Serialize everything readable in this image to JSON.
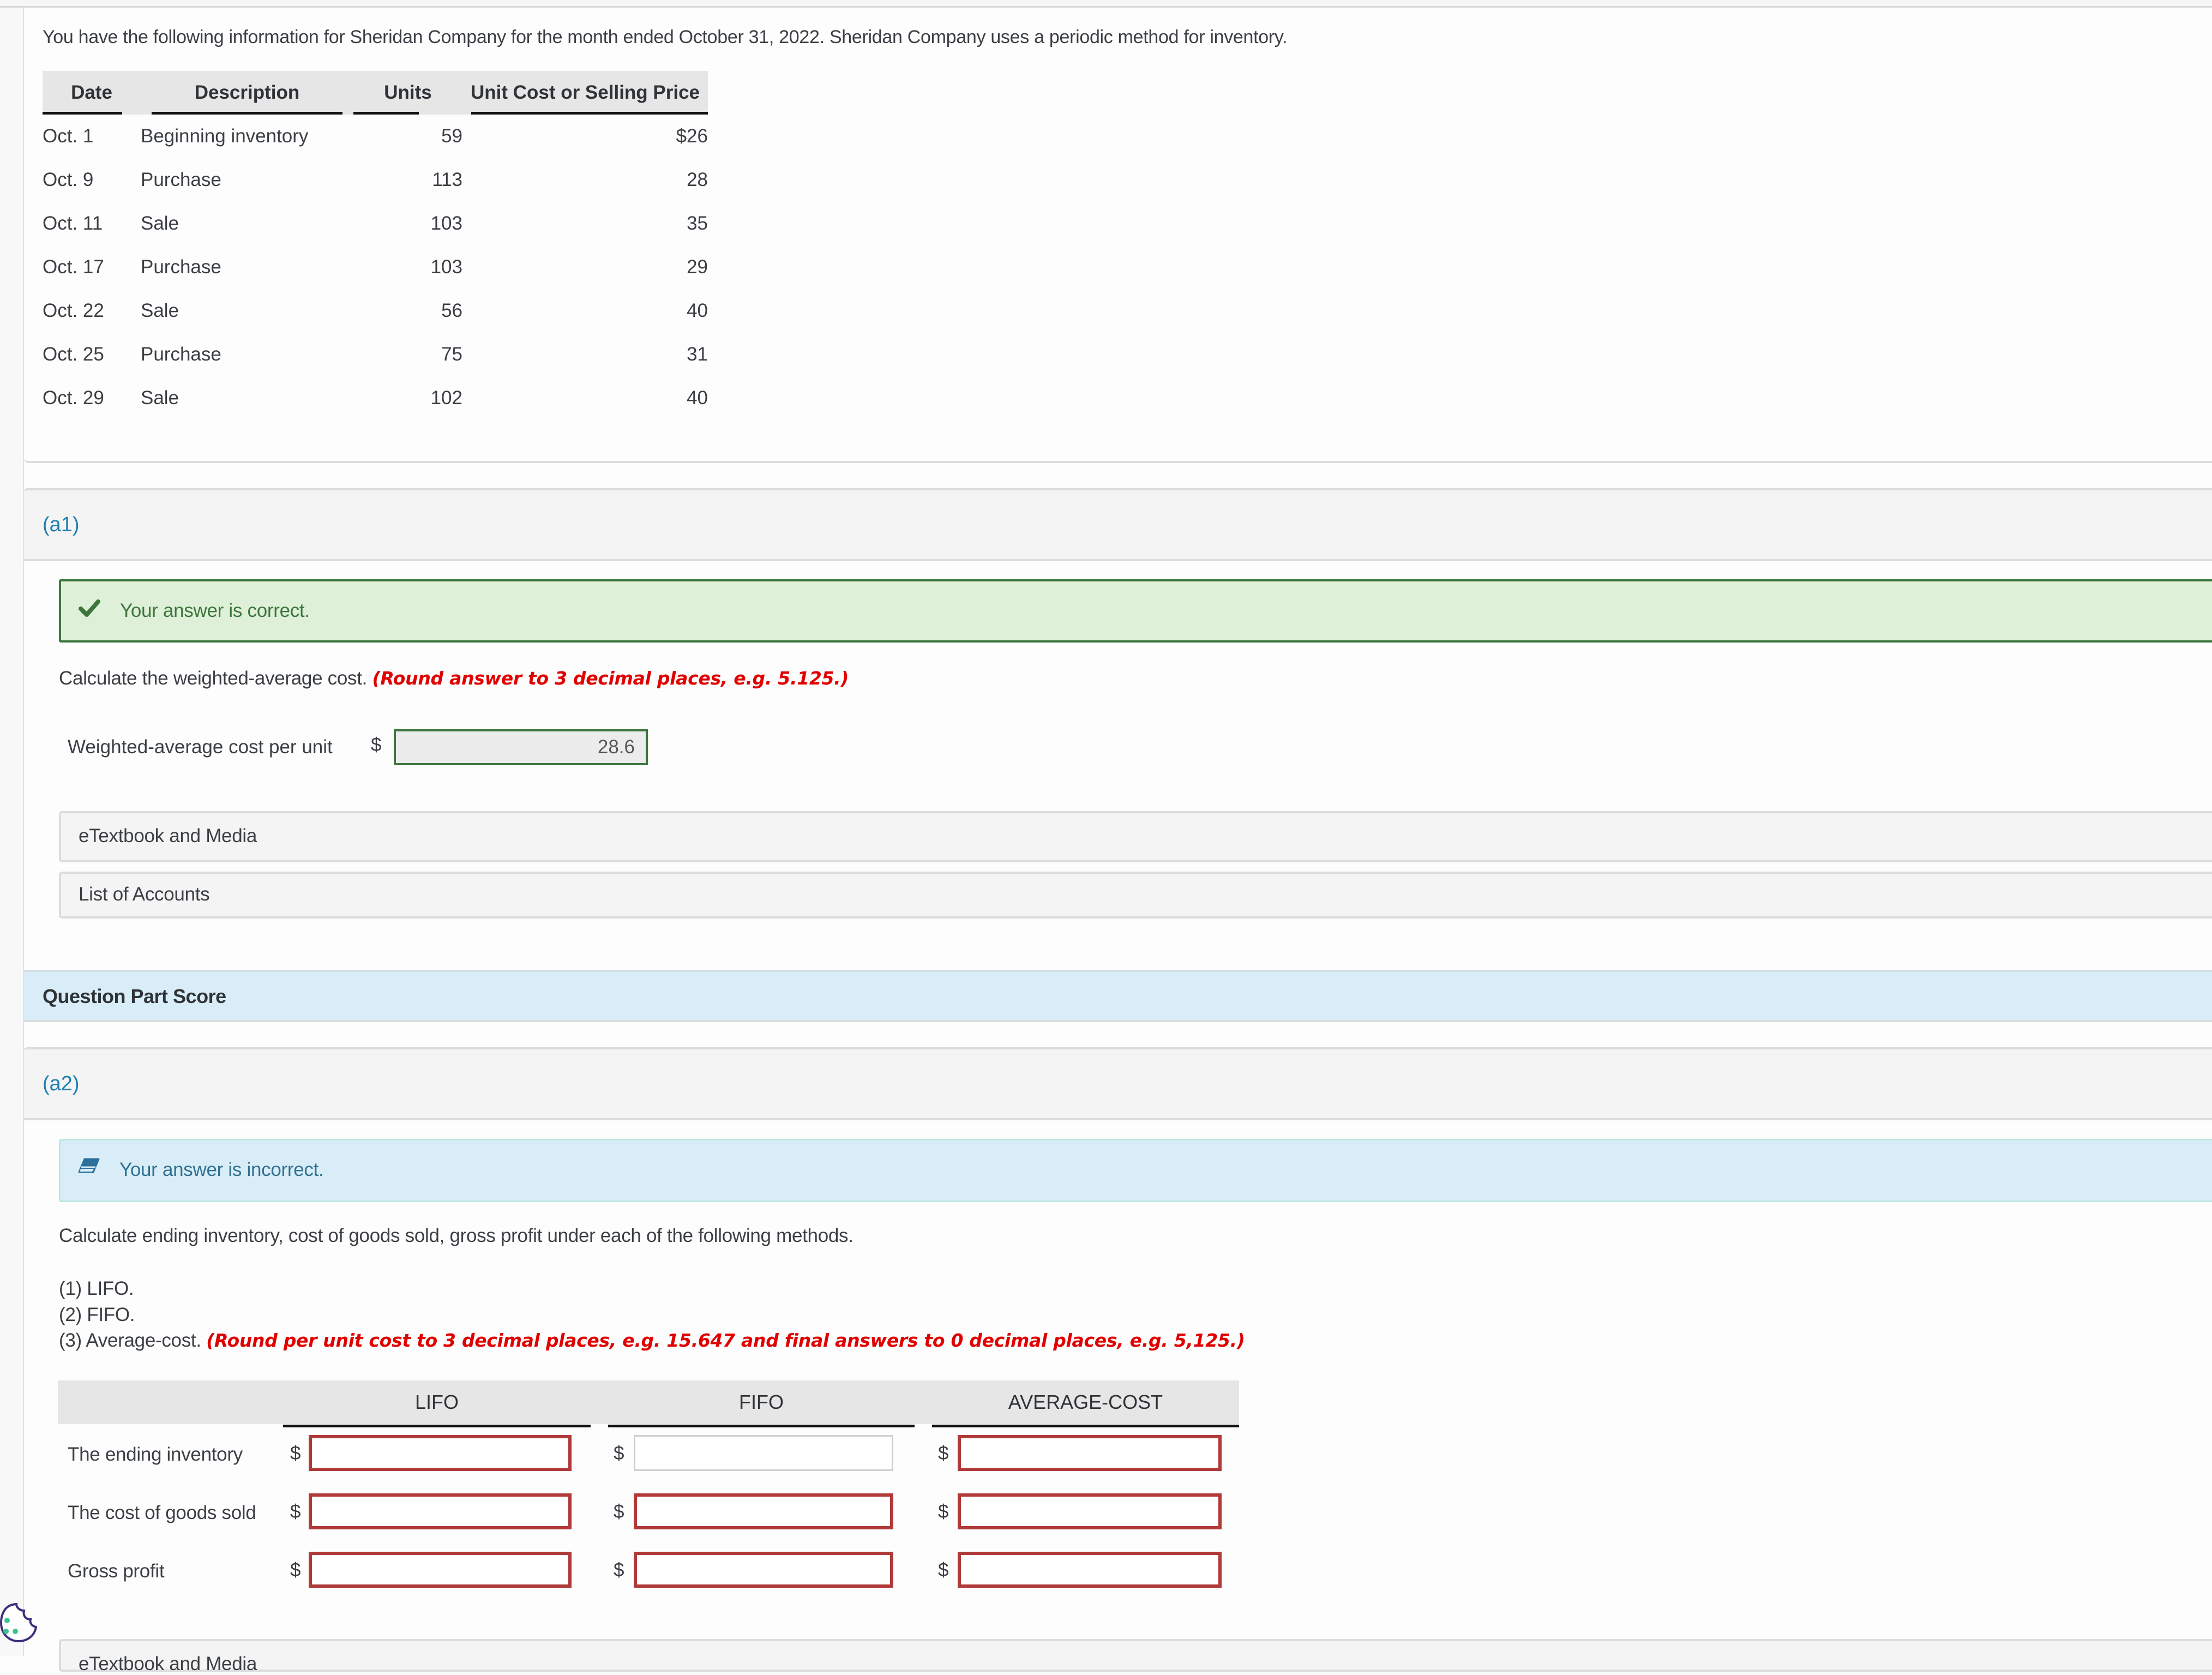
{
  "intro": {
    "text": "You have the following information for Sheridan Company for the month ended October 31, 2022. Sheridan Company uses a periodic method for inventory."
  },
  "inventory_table": {
    "headers": [
      "Date",
      "Description",
      "Units",
      "Unit Cost or Selling Price"
    ],
    "rows": [
      {
        "date": "Oct. 1",
        "description": "Beginning inventory",
        "units": "59",
        "price": "$26"
      },
      {
        "date": "Oct. 9",
        "description": "Purchase",
        "units": "113",
        "price": "28"
      },
      {
        "date": "Oct. 11",
        "description": "Sale",
        "units": "103",
        "price": "35"
      },
      {
        "date": "Oct. 17",
        "description": "Purchase",
        "units": "103",
        "price": "29"
      },
      {
        "date": "Oct. 22",
        "description": "Sale",
        "units": "56",
        "price": "40"
      },
      {
        "date": "Oct. 25",
        "description": "Purchase",
        "units": "75",
        "price": "31"
      },
      {
        "date": "Oct. 29",
        "description": "Sale",
        "units": "102",
        "price": "40"
      }
    ]
  },
  "part_a1": {
    "label": "(a1)",
    "status": {
      "icon": "checkmark-icon",
      "message": "Your answer is correct.",
      "color": "#3c763d"
    },
    "instruction": "Calculate the weighted-average cost.",
    "instruction_note": "(Round answer to 3 decimal places, e.g. 5.125.)",
    "field_label": "Weighted-average cost per unit",
    "currency": "$",
    "field_value": "28.6",
    "resources": [
      "eTextbook and Media",
      "List of Accounts"
    ]
  },
  "question_part_score": {
    "label": "Question Part Score"
  },
  "part_a2": {
    "label": "(a2)",
    "status": {
      "icon": "eraser-icon",
      "message": "Your answer is incorrect.",
      "color": "#31708f"
    },
    "instruction": "Calculate ending inventory, cost of goods sold, gross profit under each of the following methods.",
    "methods": [
      "(1) LIFO.",
      "(2) FIFO.",
      "(3) Average-cost."
    ],
    "methods_note": "(Round per unit cost to 3 decimal places, e.g. 15.647 and final answers to 0 decimal places, e.g. 5,125.)",
    "columns": [
      "LIFO",
      "FIFO",
      "AVERAGE-COST"
    ],
    "currency": "$",
    "rows": [
      {
        "label": "The ending inventory",
        "values": [
          "",
          "",
          ""
        ],
        "states": [
          "incorrect",
          "blank",
          "incorrect"
        ]
      },
      {
        "label": "The cost of goods sold",
        "values": [
          "",
          "",
          ""
        ],
        "states": [
          "incorrect",
          "incorrect",
          "incorrect"
        ]
      },
      {
        "label": "Gross profit",
        "values": [
          "",
          "",
          ""
        ],
        "states": [
          "incorrect",
          "incorrect",
          "incorrect"
        ]
      }
    ],
    "resources": [
      "eTextbook and Media"
    ]
  },
  "colors": {
    "link_blue": "#1e7fb0",
    "correct_green": "#3c763d",
    "correct_bg": "#dff0d8",
    "info_bg": "#d8edf8",
    "error_red": "#b03a3a",
    "note_red": "#e00000"
  }
}
